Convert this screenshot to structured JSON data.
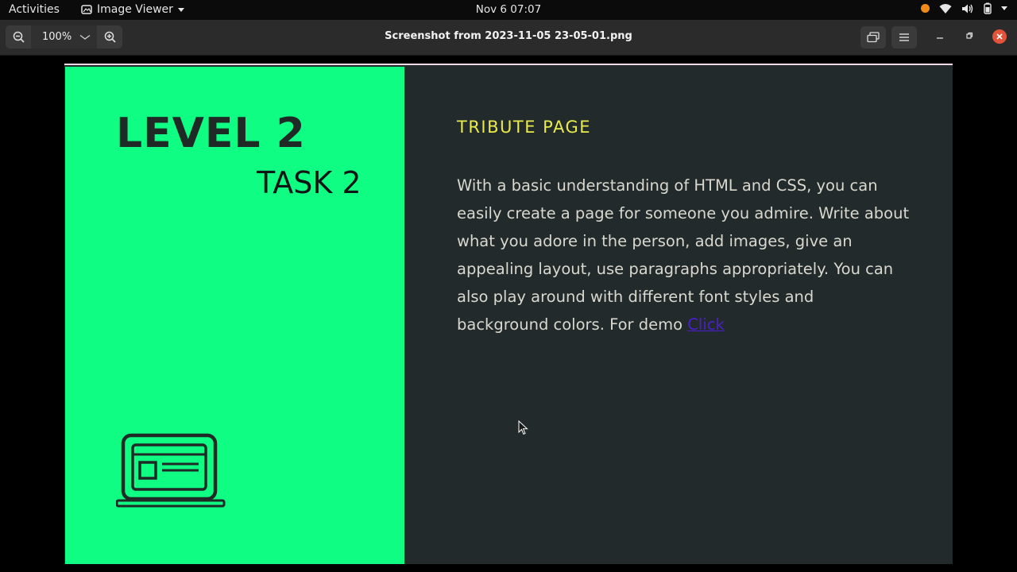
{
  "topbar": {
    "activities": "Activities",
    "app_name": "Image Viewer",
    "clock": "Nov 6  07:07"
  },
  "viewer": {
    "zoom_level": "100%",
    "title": "Screenshot from 2023-11-05 23-05-01.png"
  },
  "page": {
    "level": "LEVEL 2",
    "task": "TASK 2",
    "heading": "TRIBUTE PAGE",
    "paragraph": "With a basic understanding of HTML and CSS, you can easily create a page for someone you admire. Write about what you adore in the person, add images, give an appealing layout, use paragraphs appropriately. You can also play around with different font styles and background colors. For demo ",
    "link_text": "Click"
  },
  "colors": {
    "left_panel": "#0ffd83",
    "right_panel": "#232a2b",
    "heading": "#e9ea4c",
    "link": "#4a1fd0",
    "close": "#e2533a"
  }
}
